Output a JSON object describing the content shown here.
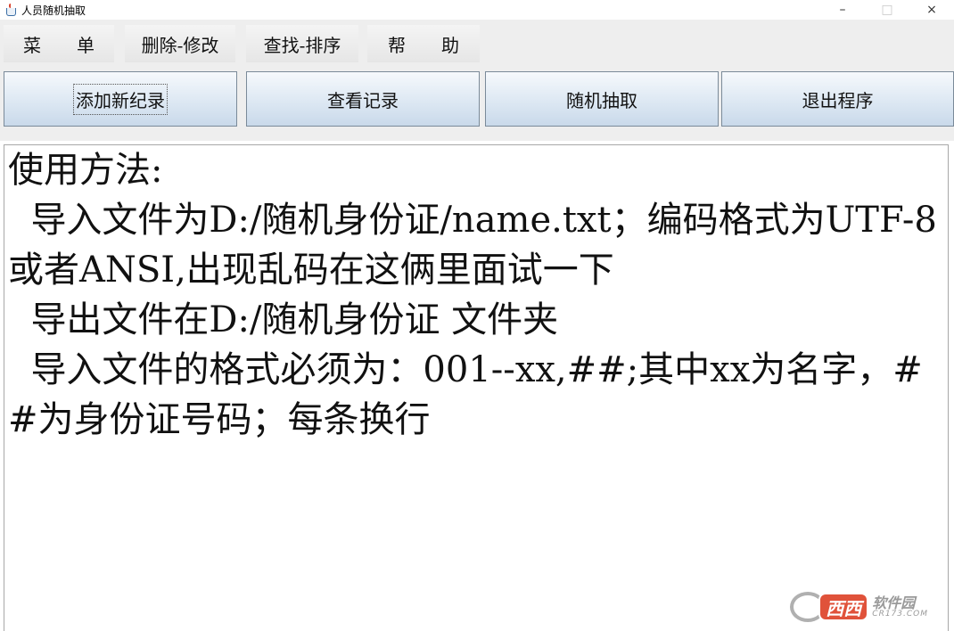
{
  "window": {
    "title": "人员随机抽取",
    "minimize_glyph": "–",
    "maximize_glyph": "□",
    "close_glyph": "×"
  },
  "menu": {
    "items": [
      {
        "label": "菜　　单"
      },
      {
        "label": "删除-修改"
      },
      {
        "label": "查找-排序"
      },
      {
        "label": "帮　　助"
      }
    ]
  },
  "toolbar": {
    "buttons": [
      {
        "label": "添加新纪录"
      },
      {
        "label": "查看记录"
      },
      {
        "label": "随机抽取"
      },
      {
        "label": "退出程序"
      }
    ]
  },
  "text_area": {
    "content": "使用方法:\n  导入文件为D:/随机身份证/name.txt；编码格式为UTF-8或者ANSI,出现乱码在这俩里面试一下\n  导出文件在D:/随机身份证 文件夹\n  导入文件的格式必须为：001--xx,##;其中xx为名字，##为身份证号码；每条换行"
  },
  "watermark": {
    "badge": "西西",
    "cn": "软件园",
    "en": "CR173.COM"
  },
  "icons": {
    "app": "java-coffee-cup-icon"
  },
  "colors": {
    "toolbar_gradient_top": "#f6f9fc",
    "toolbar_gradient_bottom": "#c9d9ea",
    "panel_background": "#eeeeee",
    "watermark_badge": "#e0523a"
  }
}
